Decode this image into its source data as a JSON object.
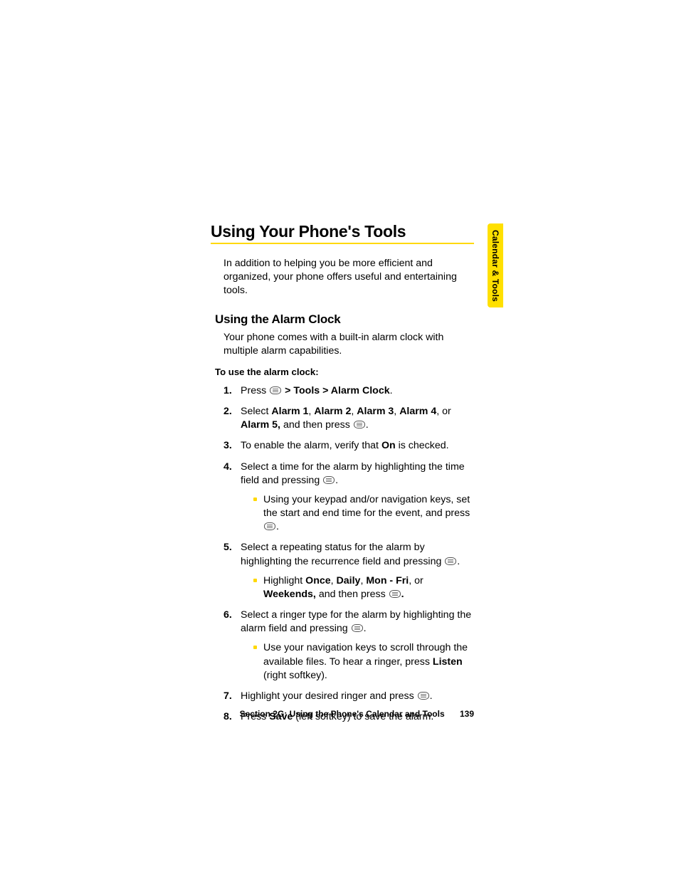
{
  "sideTab": "Calendar & Tools",
  "heading1": "Using Your Phone's Tools",
  "intro": "In addition to helping you be more efficient and organized, your phone offers useful and entertaining tools.",
  "heading2": "Using the Alarm Clock",
  "para1": "Your phone comes with a built-in alarm clock with multiple alarm capabilities.",
  "lead": "To use the alarm clock:",
  "steps": {
    "s1a": "Press ",
    "s1b": " > Tools > Alarm Clock",
    "s1c": ".",
    "s2a": "Select ",
    "s2a1": "Alarm 1",
    "s2c1": ", ",
    "s2a2": "Alarm 2",
    "s2c2": ", ",
    "s2a3": "Alarm 3",
    "s2c3": ", ",
    "s2a4": "Alarm 4",
    "s2c4": ", or ",
    "s2a5": "Alarm 5,",
    "s2e": " and then press ",
    "s2f": ".",
    "s3a": "To enable the alarm, verify that ",
    "s3b": "On",
    "s3c": " is checked.",
    "s4a": "Select a time for the alarm by highlighting the time field and pressing ",
    "s4b": ".",
    "s4sub": "Using your keypad and/or navigation keys, set the start and end time for the event, and press ",
    "s4sub2": ".",
    "s5a": "Select a repeating status for the alarm by highlighting the recurrence field and pressing ",
    "s5b": ".",
    "s5subA": "Highlight ",
    "s5o1": "Once",
    "s5sep1": ", ",
    "s5o2": "Daily",
    "s5sep2": ", ",
    "s5o3": "Mon - Fri",
    "s5sep3": ", or ",
    "s5o4": "Weekends,",
    "s5subB": " and then press ",
    "s5subC": ".",
    "s6a": "Select a ringer type for the alarm by highlighting the alarm field and pressing ",
    "s6b": ".",
    "s6subA": "Use your navigation keys to scroll through the available files. To hear a ringer, press ",
    "s6subB": "Listen",
    "s6subC": " (right softkey).",
    "s7a": "Highlight your desired ringer and press ",
    "s7b": ".",
    "s8a": "Press ",
    "s8b": "Save",
    "s8c": " (left softkey) to save the alarm."
  },
  "footer": {
    "label": "Section 2G: Using the Phone's Calendar and Tools",
    "page": "139"
  }
}
